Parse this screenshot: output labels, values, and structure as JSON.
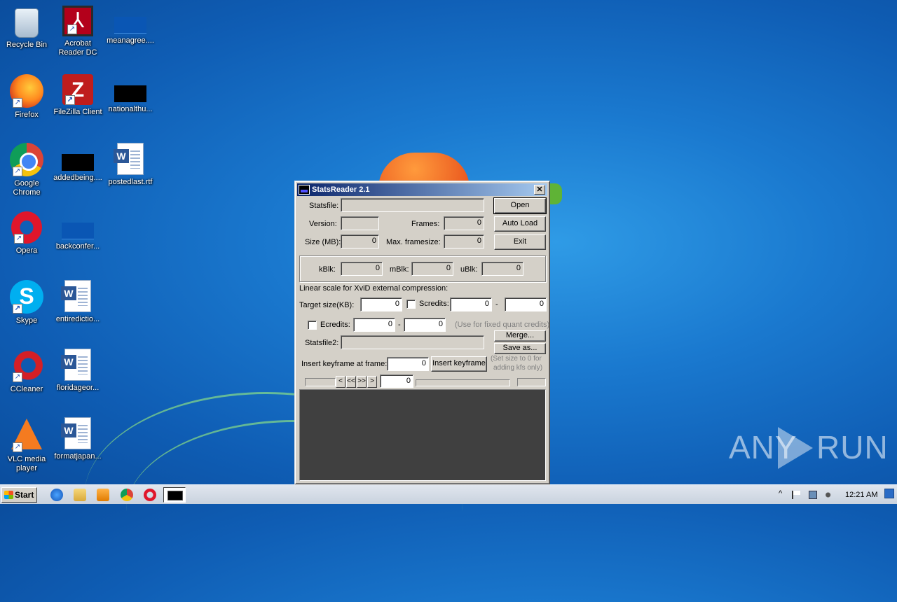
{
  "desktop": {
    "icons": [
      {
        "label": "Recycle Bin"
      },
      {
        "label": "Acrobat\nReader DC"
      },
      {
        "label": "meanagree...."
      },
      {
        "label": "Firefox"
      },
      {
        "label": "FileZilla Client"
      },
      {
        "label": "nationalthu..."
      },
      {
        "label": "Google\nChrome"
      },
      {
        "label": "addedbeing...."
      },
      {
        "label": "postedlast.rtf"
      },
      {
        "label": "Opera"
      },
      {
        "label": "backconfer..."
      },
      {
        "label": "Skype"
      },
      {
        "label": "entiredictio..."
      },
      {
        "label": "CCleaner"
      },
      {
        "label": "floridageor..."
      },
      {
        "label": "VLC media\nplayer"
      },
      {
        "label": "formatjapan..."
      }
    ]
  },
  "dialog": {
    "title": "StatsReader 2.1",
    "close_glyph": "✕",
    "statsfile_label": "Statsfile:",
    "statsfile_value": "",
    "open_button": "Open",
    "version_label": "Version:",
    "version_value": "",
    "frames_label": "Frames:",
    "frames_value": "0",
    "autoload_button": "Auto Load",
    "size_label": "Size (MB):",
    "size_value": "0",
    "maxframe_label": "Max. framesize:",
    "maxframe_value": "0",
    "exit_button": "Exit",
    "kblk_label": "kBlk:",
    "kblk_value": "0",
    "mblk_label": "mBlk:",
    "mblk_value": "0",
    "ublk_label": "uBlk:",
    "ublk_value": "0",
    "linear_label": "Linear scale for XviD external compression:",
    "target_label": "Target size(KB):",
    "target_value": "0",
    "scredits_label": "Scredits:",
    "scredits_from": "0",
    "scredits_dash": "-",
    "scredits_to": "0",
    "ecredits_label": "Ecredits:",
    "ecredits_from": "0",
    "ecredits_dash": "-",
    "ecredits_to": "0",
    "fixed_quant_hint": "(Use for fixed quant credits)",
    "merge_button": "Merge...",
    "statsfile2_label": "Statsfile2:",
    "statsfile2_value": "",
    "saveas_button": "Save as...",
    "insert_kf_label": "Insert keyframe at frame:",
    "insert_kf_value": "0",
    "insert_kf_button": "Insert keyframe",
    "kf_hint_line1": "(Set size to 0 for",
    "kf_hint_line2": "adding kfs only)",
    "nav_prev": "<",
    "nav_rew": "<<",
    "nav_ff": ">>",
    "nav_next": ">",
    "frame_value": "0"
  },
  "taskbar": {
    "start_label": "Start",
    "clock": "12:21 AM",
    "tray_expand": "^"
  },
  "watermark": {
    "left": "ANY",
    "right": "RUN"
  }
}
